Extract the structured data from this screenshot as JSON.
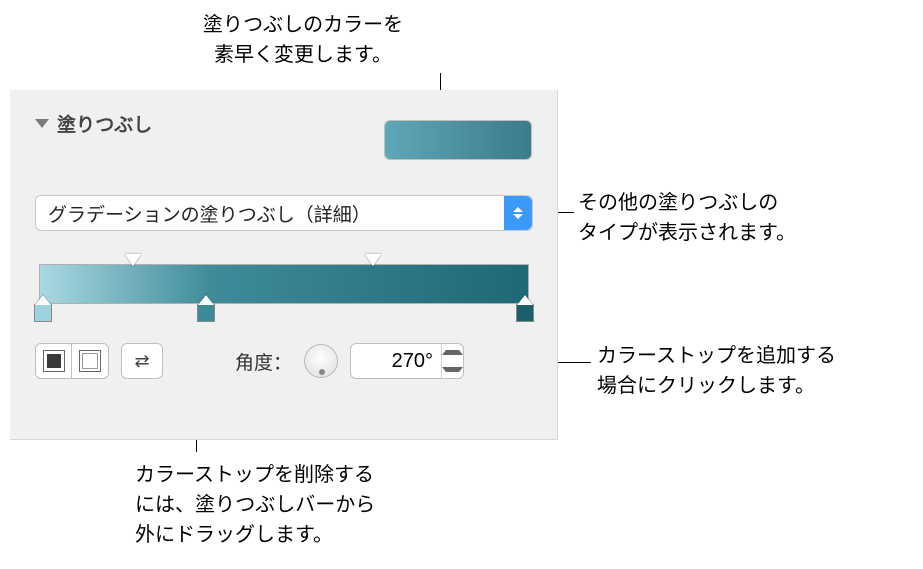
{
  "callouts": {
    "top": "塗りつぶしのカラーを\n素早く変更します。",
    "right1": "その他の塗りつぶしの\nタイプが表示されます。",
    "right2": "カラーストップを追加する\n場合にクリックします。",
    "bottom": "カラーストップを削除する\nには、塗りつぶしバーから\n外にドラッグします。"
  },
  "fill": {
    "section_title": "塗りつぶし",
    "type_select": "グラデーションの塗りつぶし（詳細）",
    "gradient_stops": [
      {
        "position": 0,
        "color": "#9cd3de"
      },
      {
        "position": 34,
        "color": "#3a8c9b"
      },
      {
        "position": 100,
        "color": "#1b5f6c"
      }
    ],
    "angle_label": "角度：",
    "angle_value": "270°"
  }
}
